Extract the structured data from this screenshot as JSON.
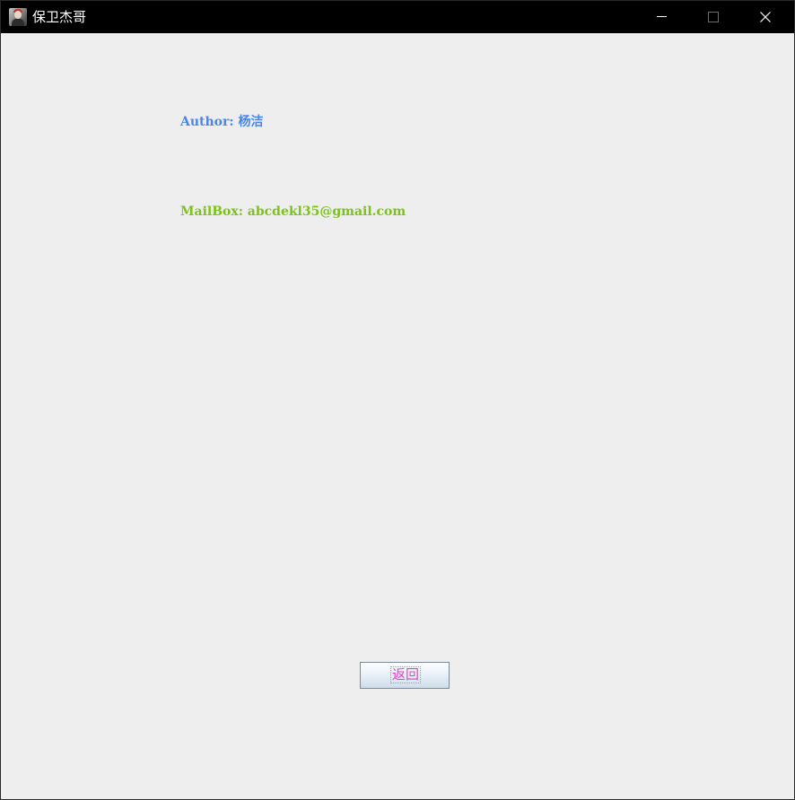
{
  "window": {
    "title": "保卫杰哥",
    "icon": "app-avatar-icon",
    "controls": {
      "minimize": "minimize-icon",
      "maximize": "maximize-icon",
      "close": "close-icon"
    }
  },
  "about": {
    "author_label": "Author:",
    "author_name": "杨洁",
    "mailbox_label": "MailBox:",
    "mailbox_value": "abcdekl35@gmail.com"
  },
  "buttons": {
    "return_label": "返回"
  },
  "colors": {
    "titlebar": "#000000",
    "background": "#eeeeee",
    "author_text": "#4a86e8",
    "mailbox_text": "#7cc21a",
    "button_text": "#e040d0"
  }
}
